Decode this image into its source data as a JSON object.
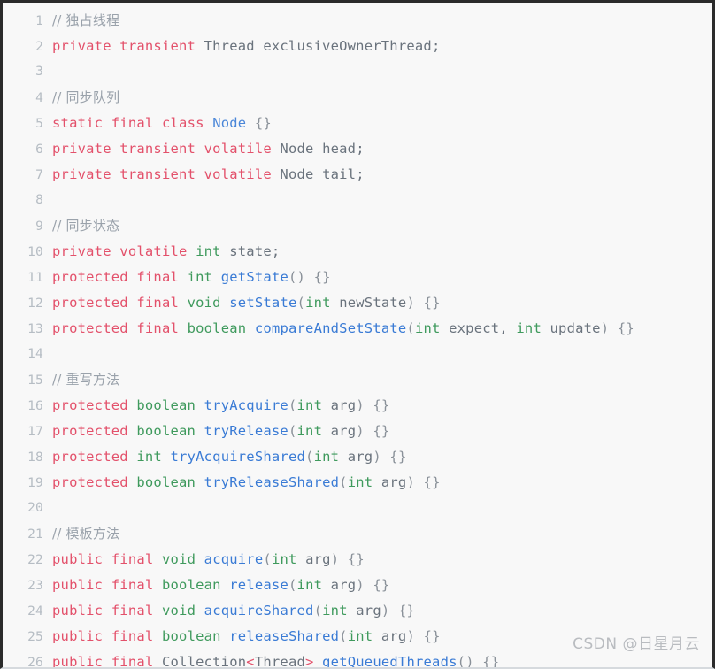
{
  "editor": {
    "language": "java",
    "background_color": "#f8f8f8",
    "border_color": "#2b2b2b",
    "gutter_color": "#b6bdc4",
    "colors": {
      "keyword": "#e3516b",
      "type": "#3f9a5d",
      "function": "#3a7bd5",
      "class": "#4a86d8",
      "comment": "#9aa2ab",
      "plain": "#6a737d"
    },
    "lines": [
      {
        "number": "1",
        "tokens": [
          {
            "t": "// 独占线程",
            "c": "cmt"
          }
        ]
      },
      {
        "number": "2",
        "tokens": [
          {
            "t": "private",
            "c": "kw"
          },
          {
            "t": " ",
            "c": "plain"
          },
          {
            "t": "transient",
            "c": "kw"
          },
          {
            "t": " Thread exclusiveOwnerThread;",
            "c": "plain"
          }
        ]
      },
      {
        "number": "3",
        "tokens": []
      },
      {
        "number": "4",
        "tokens": [
          {
            "t": "// 同步队列",
            "c": "cmt"
          }
        ]
      },
      {
        "number": "5",
        "tokens": [
          {
            "t": "static",
            "c": "kw"
          },
          {
            "t": " ",
            "c": "plain"
          },
          {
            "t": "final",
            "c": "kw"
          },
          {
            "t": " ",
            "c": "plain"
          },
          {
            "t": "class",
            "c": "kw"
          },
          {
            "t": " ",
            "c": "plain"
          },
          {
            "t": "Node",
            "c": "cls"
          },
          {
            "t": " ",
            "c": "plain"
          },
          {
            "t": "{}",
            "c": "punct"
          }
        ]
      },
      {
        "number": "6",
        "tokens": [
          {
            "t": "private",
            "c": "kw"
          },
          {
            "t": " ",
            "c": "plain"
          },
          {
            "t": "transient",
            "c": "kw"
          },
          {
            "t": " ",
            "c": "plain"
          },
          {
            "t": "volatile",
            "c": "kw"
          },
          {
            "t": " Node head;",
            "c": "plain"
          }
        ]
      },
      {
        "number": "7",
        "tokens": [
          {
            "t": "private",
            "c": "kw"
          },
          {
            "t": " ",
            "c": "plain"
          },
          {
            "t": "transient",
            "c": "kw"
          },
          {
            "t": " ",
            "c": "plain"
          },
          {
            "t": "volatile",
            "c": "kw"
          },
          {
            "t": " Node tail;",
            "c": "plain"
          }
        ]
      },
      {
        "number": "8",
        "tokens": []
      },
      {
        "number": "9",
        "tokens": [
          {
            "t": "// 同步状态",
            "c": "cmt"
          }
        ]
      },
      {
        "number": "10",
        "tokens": [
          {
            "t": "private",
            "c": "kw"
          },
          {
            "t": " ",
            "c": "plain"
          },
          {
            "t": "volatile",
            "c": "kw"
          },
          {
            "t": " ",
            "c": "plain"
          },
          {
            "t": "int",
            "c": "type"
          },
          {
            "t": " state;",
            "c": "plain"
          }
        ]
      },
      {
        "number": "11",
        "tokens": [
          {
            "t": "protected",
            "c": "kw"
          },
          {
            "t": " ",
            "c": "plain"
          },
          {
            "t": "final",
            "c": "kw"
          },
          {
            "t": " ",
            "c": "plain"
          },
          {
            "t": "int",
            "c": "type"
          },
          {
            "t": " ",
            "c": "plain"
          },
          {
            "t": "getState",
            "c": "fn"
          },
          {
            "t": "()",
            "c": "punct"
          },
          {
            "t": " ",
            "c": "plain"
          },
          {
            "t": "{}",
            "c": "punct"
          }
        ]
      },
      {
        "number": "12",
        "tokens": [
          {
            "t": "protected",
            "c": "kw"
          },
          {
            "t": " ",
            "c": "plain"
          },
          {
            "t": "final",
            "c": "kw"
          },
          {
            "t": " ",
            "c": "plain"
          },
          {
            "t": "void",
            "c": "type"
          },
          {
            "t": " ",
            "c": "plain"
          },
          {
            "t": "setState",
            "c": "fn"
          },
          {
            "t": "(",
            "c": "punct"
          },
          {
            "t": "int",
            "c": "type"
          },
          {
            "t": " newState",
            "c": "plain"
          },
          {
            "t": ")",
            "c": "punct"
          },
          {
            "t": " ",
            "c": "plain"
          },
          {
            "t": "{}",
            "c": "punct"
          }
        ]
      },
      {
        "number": "13",
        "tokens": [
          {
            "t": "protected",
            "c": "kw"
          },
          {
            "t": " ",
            "c": "plain"
          },
          {
            "t": "final",
            "c": "kw"
          },
          {
            "t": " ",
            "c": "plain"
          },
          {
            "t": "boolean",
            "c": "type"
          },
          {
            "t": " ",
            "c": "plain"
          },
          {
            "t": "compareAndSetState",
            "c": "fn"
          },
          {
            "t": "(",
            "c": "punct"
          },
          {
            "t": "int",
            "c": "type"
          },
          {
            "t": " expect, ",
            "c": "plain"
          },
          {
            "t": "int",
            "c": "type"
          },
          {
            "t": " update",
            "c": "plain"
          },
          {
            "t": ")",
            "c": "punct"
          },
          {
            "t": " ",
            "c": "plain"
          },
          {
            "t": "{}",
            "c": "punct"
          }
        ]
      },
      {
        "number": "14",
        "tokens": []
      },
      {
        "number": "15",
        "tokens": [
          {
            "t": "// 重写方法",
            "c": "cmt"
          }
        ]
      },
      {
        "number": "16",
        "tokens": [
          {
            "t": "protected",
            "c": "kw"
          },
          {
            "t": " ",
            "c": "plain"
          },
          {
            "t": "boolean",
            "c": "type"
          },
          {
            "t": " ",
            "c": "plain"
          },
          {
            "t": "tryAcquire",
            "c": "fn"
          },
          {
            "t": "(",
            "c": "punct"
          },
          {
            "t": "int",
            "c": "type"
          },
          {
            "t": " arg",
            "c": "plain"
          },
          {
            "t": ")",
            "c": "punct"
          },
          {
            "t": " ",
            "c": "plain"
          },
          {
            "t": "{}",
            "c": "punct"
          }
        ]
      },
      {
        "number": "17",
        "tokens": [
          {
            "t": "protected",
            "c": "kw"
          },
          {
            "t": " ",
            "c": "plain"
          },
          {
            "t": "boolean",
            "c": "type"
          },
          {
            "t": " ",
            "c": "plain"
          },
          {
            "t": "tryRelease",
            "c": "fn"
          },
          {
            "t": "(",
            "c": "punct"
          },
          {
            "t": "int",
            "c": "type"
          },
          {
            "t": " arg",
            "c": "plain"
          },
          {
            "t": ")",
            "c": "punct"
          },
          {
            "t": " ",
            "c": "plain"
          },
          {
            "t": "{}",
            "c": "punct"
          }
        ]
      },
      {
        "number": "18",
        "tokens": [
          {
            "t": "protected",
            "c": "kw"
          },
          {
            "t": " ",
            "c": "plain"
          },
          {
            "t": "int",
            "c": "type"
          },
          {
            "t": " ",
            "c": "plain"
          },
          {
            "t": "tryAcquireShared",
            "c": "fn"
          },
          {
            "t": "(",
            "c": "punct"
          },
          {
            "t": "int",
            "c": "type"
          },
          {
            "t": " arg",
            "c": "plain"
          },
          {
            "t": ")",
            "c": "punct"
          },
          {
            "t": " ",
            "c": "plain"
          },
          {
            "t": "{}",
            "c": "punct"
          }
        ]
      },
      {
        "number": "19",
        "tokens": [
          {
            "t": "protected",
            "c": "kw"
          },
          {
            "t": " ",
            "c": "plain"
          },
          {
            "t": "boolean",
            "c": "type"
          },
          {
            "t": " ",
            "c": "plain"
          },
          {
            "t": "tryReleaseShared",
            "c": "fn"
          },
          {
            "t": "(",
            "c": "punct"
          },
          {
            "t": "int",
            "c": "type"
          },
          {
            "t": " arg",
            "c": "plain"
          },
          {
            "t": ")",
            "c": "punct"
          },
          {
            "t": " ",
            "c": "plain"
          },
          {
            "t": "{}",
            "c": "punct"
          }
        ]
      },
      {
        "number": "20",
        "tokens": []
      },
      {
        "number": "21",
        "tokens": [
          {
            "t": "// 模板方法",
            "c": "cmt"
          }
        ]
      },
      {
        "number": "22",
        "tokens": [
          {
            "t": "public",
            "c": "kw"
          },
          {
            "t": " ",
            "c": "plain"
          },
          {
            "t": "final",
            "c": "kw"
          },
          {
            "t": " ",
            "c": "plain"
          },
          {
            "t": "void",
            "c": "type"
          },
          {
            "t": " ",
            "c": "plain"
          },
          {
            "t": "acquire",
            "c": "fn"
          },
          {
            "t": "(",
            "c": "punct"
          },
          {
            "t": "int",
            "c": "type"
          },
          {
            "t": " arg",
            "c": "plain"
          },
          {
            "t": ")",
            "c": "punct"
          },
          {
            "t": " ",
            "c": "plain"
          },
          {
            "t": "{}",
            "c": "punct"
          }
        ]
      },
      {
        "number": "23",
        "tokens": [
          {
            "t": "public",
            "c": "kw"
          },
          {
            "t": " ",
            "c": "plain"
          },
          {
            "t": "final",
            "c": "kw"
          },
          {
            "t": " ",
            "c": "plain"
          },
          {
            "t": "boolean",
            "c": "type"
          },
          {
            "t": " ",
            "c": "plain"
          },
          {
            "t": "release",
            "c": "fn"
          },
          {
            "t": "(",
            "c": "punct"
          },
          {
            "t": "int",
            "c": "type"
          },
          {
            "t": " arg",
            "c": "plain"
          },
          {
            "t": ")",
            "c": "punct"
          },
          {
            "t": " ",
            "c": "plain"
          },
          {
            "t": "{}",
            "c": "punct"
          }
        ]
      },
      {
        "number": "24",
        "tokens": [
          {
            "t": "public",
            "c": "kw"
          },
          {
            "t": " ",
            "c": "plain"
          },
          {
            "t": "final",
            "c": "kw"
          },
          {
            "t": " ",
            "c": "plain"
          },
          {
            "t": "void",
            "c": "type"
          },
          {
            "t": " ",
            "c": "plain"
          },
          {
            "t": "acquireShared",
            "c": "fn"
          },
          {
            "t": "(",
            "c": "punct"
          },
          {
            "t": "int",
            "c": "type"
          },
          {
            "t": " arg",
            "c": "plain"
          },
          {
            "t": ")",
            "c": "punct"
          },
          {
            "t": " ",
            "c": "plain"
          },
          {
            "t": "{}",
            "c": "punct"
          }
        ]
      },
      {
        "number": "25",
        "tokens": [
          {
            "t": "public",
            "c": "kw"
          },
          {
            "t": " ",
            "c": "plain"
          },
          {
            "t": "final",
            "c": "kw"
          },
          {
            "t": " ",
            "c": "plain"
          },
          {
            "t": "boolean",
            "c": "type"
          },
          {
            "t": " ",
            "c": "plain"
          },
          {
            "t": "releaseShared",
            "c": "fn"
          },
          {
            "t": "(",
            "c": "punct"
          },
          {
            "t": "int",
            "c": "type"
          },
          {
            "t": " arg",
            "c": "plain"
          },
          {
            "t": ")",
            "c": "punct"
          },
          {
            "t": " ",
            "c": "plain"
          },
          {
            "t": "{}",
            "c": "punct"
          }
        ]
      },
      {
        "number": "26",
        "tokens": [
          {
            "t": "public",
            "c": "kw"
          },
          {
            "t": " ",
            "c": "plain"
          },
          {
            "t": "final",
            "c": "kw"
          },
          {
            "t": " Collection",
            "c": "plain"
          },
          {
            "t": "<",
            "c": "ang"
          },
          {
            "t": "Thread",
            "c": "plain"
          },
          {
            "t": ">",
            "c": "ang"
          },
          {
            "t": " ",
            "c": "plain"
          },
          {
            "t": "getQueuedThreads",
            "c": "fn"
          },
          {
            "t": "()",
            "c": "punct"
          },
          {
            "t": " ",
            "c": "plain"
          },
          {
            "t": "{}",
            "c": "punct"
          }
        ]
      }
    ]
  },
  "watermark": {
    "text": "CSDN @日星月云"
  }
}
